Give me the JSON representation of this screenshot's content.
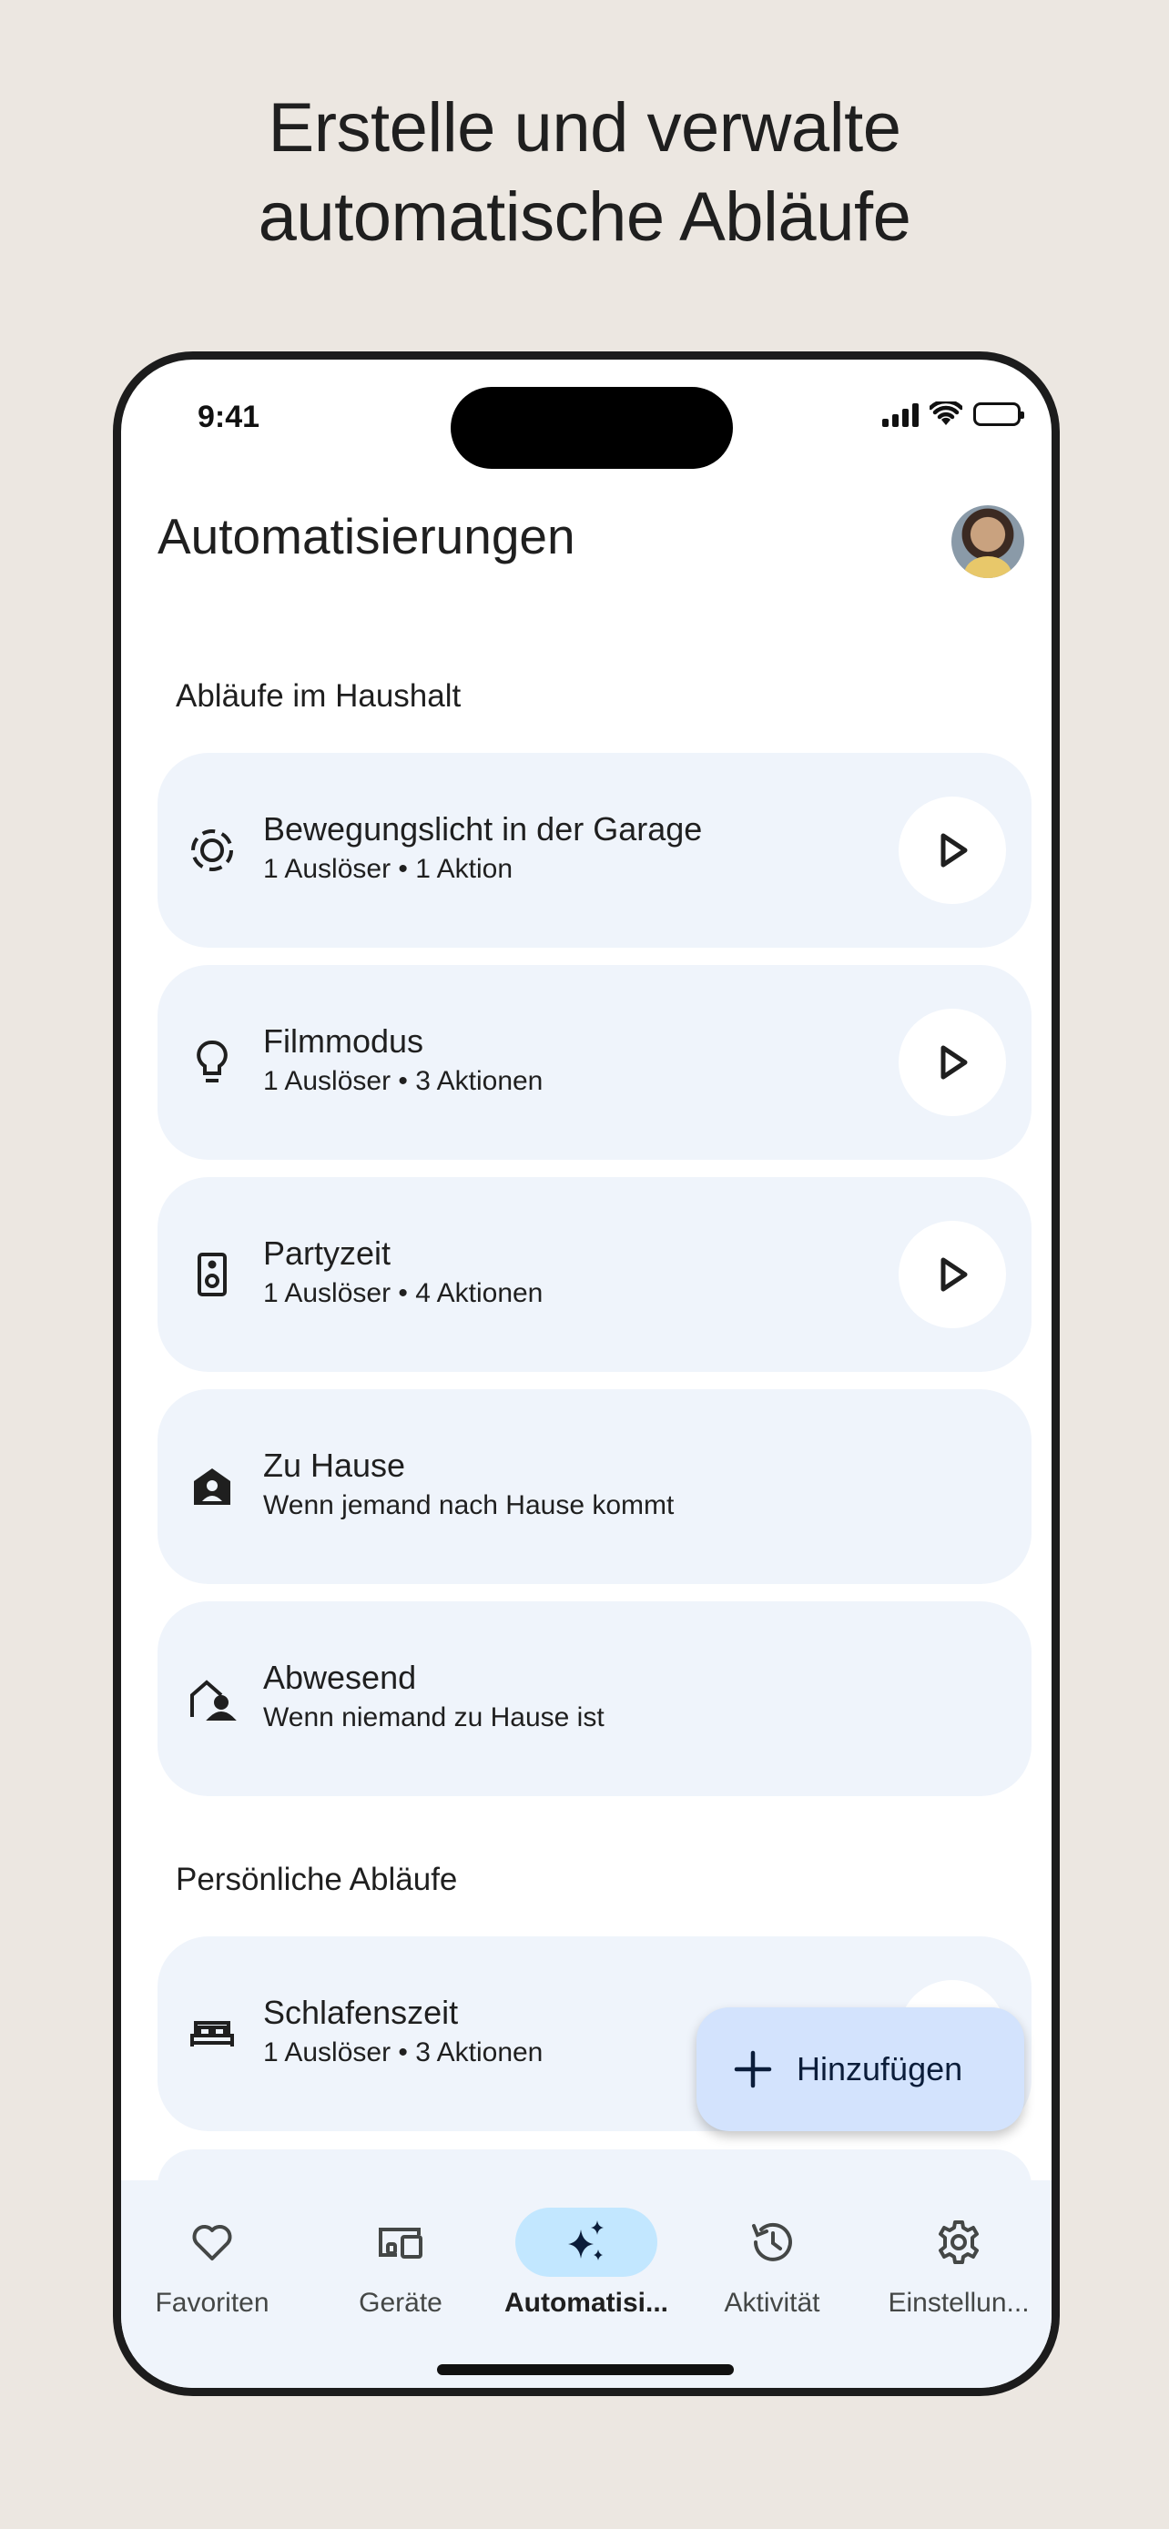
{
  "headline": {
    "line1": "Erstelle und verwalte",
    "line2": "automatische Abläufe"
  },
  "status_bar": {
    "time": "9:41"
  },
  "header": {
    "title": "Automatisierungen"
  },
  "sections": {
    "household": {
      "title": "Abläufe im Haushalt",
      "items": [
        {
          "name": "Bewegungslicht in der Garage",
          "sub": "1 Auslöser • 1 Aktion",
          "icon": "motion-sensor-icon",
          "has_play": true
        },
        {
          "name": "Filmmodus",
          "sub": "1 Auslöser • 3 Aktionen",
          "icon": "lightbulb-icon",
          "has_play": true
        },
        {
          "name": "Partyzeit",
          "sub": "1 Auslöser • 4 Aktionen",
          "icon": "speaker-icon",
          "has_play": true
        },
        {
          "name": "Zu Hause",
          "sub": "Wenn jemand nach Hause kommt",
          "icon": "home-person-icon",
          "has_play": false
        },
        {
          "name": "Abwesend",
          "sub": "Wenn niemand zu Hause ist",
          "icon": "away-person-icon",
          "has_play": false
        }
      ]
    },
    "personal": {
      "title": "Persönliche Abläufe",
      "items": [
        {
          "name": "Schlafenszeit",
          "sub": "1 Auslöser • 3 Aktionen",
          "icon": "bed-icon",
          "has_play": true
        }
      ]
    }
  },
  "fab": {
    "label": "Hinzufügen",
    "icon": "plus-icon"
  },
  "bottom_nav": [
    {
      "label": "Favoriten",
      "icon": "heart-icon",
      "active": false
    },
    {
      "label": "Geräte",
      "icon": "devices-icon",
      "active": false
    },
    {
      "label": "Automatisi...",
      "icon": "sparkle-icon",
      "active": true
    },
    {
      "label": "Aktivität",
      "icon": "history-icon",
      "active": false
    },
    {
      "label": "Einstellun...",
      "icon": "gear-icon",
      "active": false
    }
  ],
  "colors": {
    "background": "#ece7e1",
    "card": "#eff4fb",
    "active_pill": "#c2e7ff",
    "fab": "#d3e3fd"
  }
}
